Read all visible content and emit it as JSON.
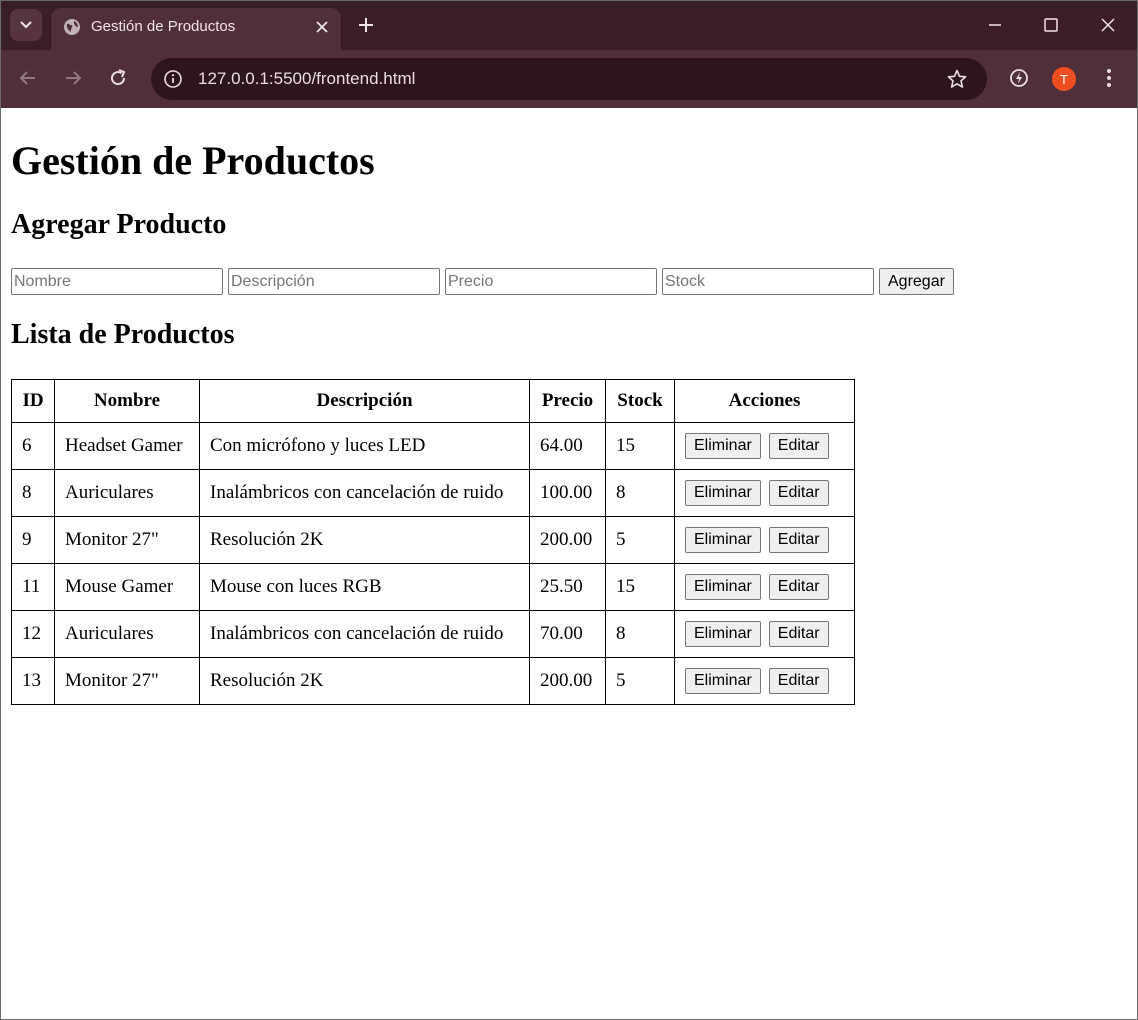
{
  "browser": {
    "tab_title": "Gestión de Productos",
    "url": "127.0.0.1:5500/frontend.html",
    "avatar_letter": "T"
  },
  "page": {
    "title": "Gestión de Productos",
    "add_heading": "Agregar Producto",
    "list_heading": "Lista de Productos",
    "form": {
      "nombre_placeholder": "Nombre",
      "descripcion_placeholder": "Descripción",
      "precio_placeholder": "Precio",
      "stock_placeholder": "Stock",
      "add_button": "Agregar"
    },
    "table": {
      "headers": [
        "ID",
        "Nombre",
        "Descripción",
        "Precio",
        "Stock",
        "Acciones"
      ],
      "rows": [
        {
          "id": "6",
          "nombre": "Headset Gamer",
          "descripcion": "Con micrófono y luces LED",
          "precio": "64.00",
          "stock": "15"
        },
        {
          "id": "8",
          "nombre": "Auriculares",
          "descripcion": "Inalámbricos con cancelación de ruido",
          "precio": "100.00",
          "stock": "8"
        },
        {
          "id": "9",
          "nombre": "Monitor 27\"",
          "descripcion": "Resolución 2K",
          "precio": "200.00",
          "stock": "5"
        },
        {
          "id": "11",
          "nombre": "Mouse Gamer",
          "descripcion": "Mouse con luces RGB",
          "precio": "25.50",
          "stock": "15"
        },
        {
          "id": "12",
          "nombre": "Auriculares",
          "descripcion": "Inalámbricos con cancelación de ruido",
          "precio": "70.00",
          "stock": "8"
        },
        {
          "id": "13",
          "nombre": "Monitor 27\"",
          "descripcion": "Resolución 2K",
          "precio": "200.00",
          "stock": "5"
        }
      ],
      "delete_label": "Eliminar",
      "edit_label": "Editar"
    }
  }
}
